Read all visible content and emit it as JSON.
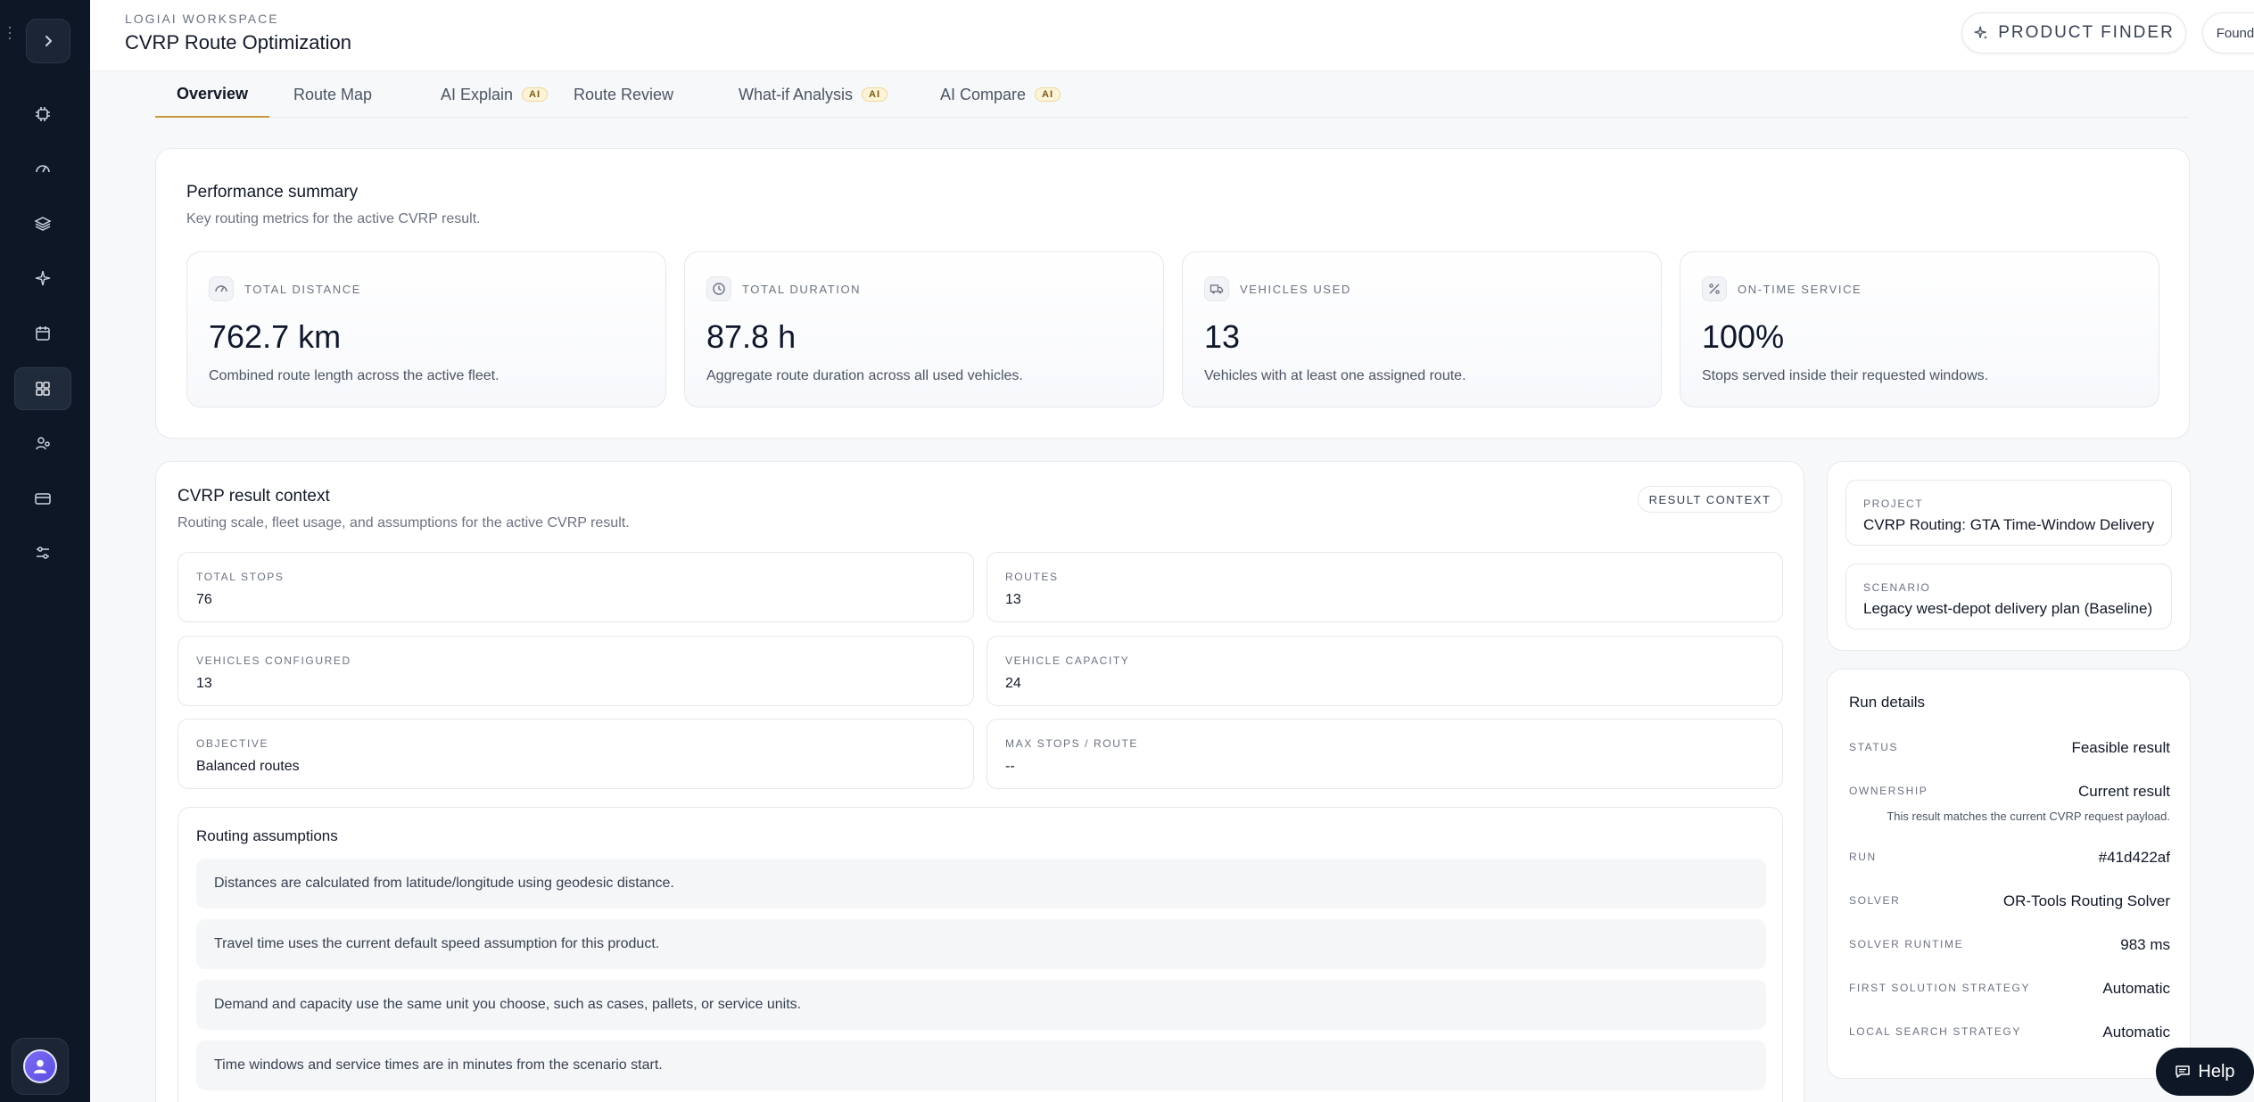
{
  "sidebar": {
    "items": [
      {
        "icon": "chip-icon"
      },
      {
        "icon": "gauge-icon"
      },
      {
        "icon": "layers-icon"
      },
      {
        "icon": "sparkle-icon"
      },
      {
        "icon": "calendar-icon"
      },
      {
        "icon": "apps-icon"
      },
      {
        "icon": "person-search-icon"
      },
      {
        "icon": "card-icon"
      },
      {
        "icon": "sliders-icon"
      }
    ]
  },
  "header": {
    "workspace_label": "LOGIAI WORKSPACE",
    "title": "CVRP Route Optimization",
    "product_finder": "PRODUCT FINDER",
    "account": "Founder account"
  },
  "tabs": [
    {
      "label": "Overview",
      "ai": ""
    },
    {
      "label": "Route Map",
      "ai": ""
    },
    {
      "label": "AI Explain",
      "ai": "AI"
    },
    {
      "label": "Route Review",
      "ai": ""
    },
    {
      "label": "What-if Analysis",
      "ai": "AI"
    },
    {
      "label": "AI Compare",
      "ai": "AI"
    }
  ],
  "performance": {
    "title": "Performance summary",
    "subtitle": "Key routing metrics for the active CVRP result.",
    "metrics": [
      {
        "label": "TOTAL DISTANCE",
        "value": "762.7 km",
        "desc": "Combined route length across the active fleet.",
        "icon": "speedometer-icon"
      },
      {
        "label": "TOTAL DURATION",
        "value": "87.8 h",
        "desc": "Aggregate route duration across all used vehicles.",
        "icon": "clock-icon"
      },
      {
        "label": "VEHICLES USED",
        "value": "13",
        "desc": "Vehicles with at least one assigned route.",
        "icon": "truck-icon"
      },
      {
        "label": "ON-TIME SERVICE",
        "value": "100%",
        "desc": "Stops served inside their requested windows.",
        "icon": "percent-icon"
      }
    ]
  },
  "context": {
    "title": "CVRP result context",
    "subtitle": "Routing scale, fleet usage, and assumptions for the active CVRP result.",
    "badge": "RESULT CONTEXT",
    "fields": [
      {
        "label": "TOTAL STOPS",
        "value": "76"
      },
      {
        "label": "ROUTES",
        "value": "13"
      },
      {
        "label": "VEHICLES CONFIGURED",
        "value": "13"
      },
      {
        "label": "VEHICLE CAPACITY",
        "value": "24"
      },
      {
        "label": "OBJECTIVE",
        "value": "Balanced routes"
      },
      {
        "label": "MAX STOPS / ROUTE",
        "value": "--"
      }
    ],
    "assumptions_title": "Routing assumptions",
    "assumptions": [
      "Distances are calculated from latitude/longitude using geodesic distance.",
      "Travel time uses the current default speed assumption for this product.",
      "Demand and capacity use the same unit you choose, such as cases, pallets, or service units.",
      "Time windows and service times are in minutes from the scenario start."
    ]
  },
  "project": {
    "project_label": "PROJECT",
    "project_value": "CVRP Routing: GTA Time-Window Delivery",
    "scenario_label": "SCENARIO",
    "scenario_value": "Legacy west-depot delivery plan (Baseline)"
  },
  "run": {
    "title": "Run details",
    "status_label": "STATUS",
    "status_value": "Feasible result",
    "ownership_label": "OWNERSHIP",
    "ownership_value": "Current result",
    "ownership_note": "This result matches the current CVRP request payload.",
    "run_label": "RUN",
    "run_value": "#41d422af",
    "solver_label": "SOLVER",
    "solver_value": "OR-Tools Routing Solver",
    "runtime_label": "SOLVER RUNTIME",
    "runtime_value": "983 ms",
    "first_label": "FIRST SOLUTION STRATEGY",
    "first_value": "Automatic",
    "local_label": "LOCAL SEARCH STRATEGY",
    "local_value": "Automatic"
  },
  "help": {
    "label": "Help"
  },
  "colors": {
    "sidebar": "#0e1726",
    "accent": "#c89a3c",
    "ai_badge_bg": "#fdf3d8"
  }
}
